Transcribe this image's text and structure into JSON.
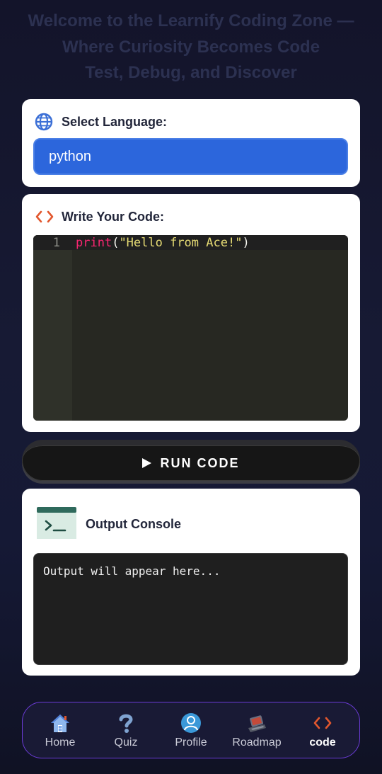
{
  "header": {
    "title_line1": "Welcome to the Learnify Coding Zone —",
    "title_line2": "Where Curiosity Becomes Code",
    "title_line3": "Test, Debug, and Discover"
  },
  "language": {
    "label": "Select Language:",
    "selected": "python",
    "icon": "globe-icon"
  },
  "editor": {
    "label": "Write Your Code:",
    "icon": "code-brackets-icon",
    "line_number": "1",
    "code_fn": "print",
    "code_open": "(",
    "code_str": "\"Hello from Ace!\"",
    "code_close": ")"
  },
  "run_button": {
    "label": "RUN CODE",
    "icon": "play-icon"
  },
  "output": {
    "label": "Output Console",
    "placeholder": "Output will appear here...",
    "icon": "terminal-icon"
  },
  "nav": {
    "items": [
      {
        "label": "Home",
        "icon": "home-icon"
      },
      {
        "label": "Quiz",
        "icon": "question-icon"
      },
      {
        "label": "Profile",
        "icon": "user-icon"
      },
      {
        "label": "Roadmap",
        "icon": "roadmap-icon"
      },
      {
        "label": "code",
        "icon": "code-brackets-icon"
      }
    ],
    "active": "code"
  },
  "colors": {
    "accent_blue": "#2c66dc",
    "code_orange": "#e2572e",
    "nav_border": "#6b3bd6",
    "editor_bg": "#272822"
  }
}
